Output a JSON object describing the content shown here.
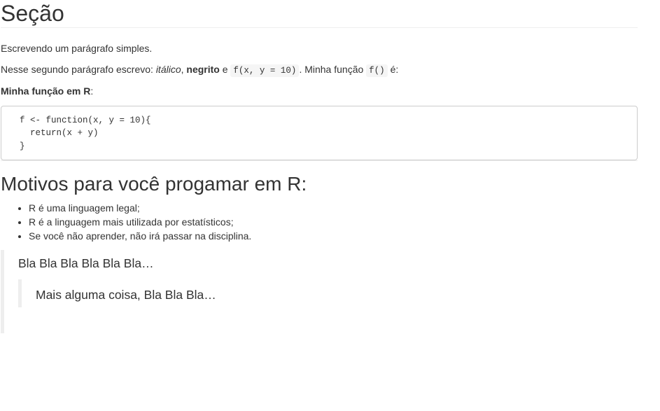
{
  "section": {
    "title": "Seção"
  },
  "paragraphs": {
    "p1": "Escrevendo um parágrafo simples.",
    "p2": {
      "prefix": "Nesse segundo parágrafo escrevo: ",
      "italic": "itálico",
      "sep1": ", ",
      "bold": "negrito",
      "sep2": " e ",
      "code1": "f(x, y = 10)",
      "mid": ". Minha função ",
      "code2": "f()",
      "suffix": " é:"
    },
    "p3": {
      "bold": "Minha função em R",
      "suffix": ":"
    }
  },
  "code_block": "f <- function(x, y = 10){\n  return(x + y)\n}",
  "subsection": {
    "title": "Motivos para você progamar em R:",
    "items": [
      "R é uma linguagem legal;",
      "R é a linguagem mais utilizada por estatísticos;",
      "Se você não aprender, não irá passar na disciplina."
    ]
  },
  "quotes": {
    "outer": "Bla Bla Bla Bla Bla Bla…",
    "inner": "Mais alguma coisa, Bla Bla Bla…"
  }
}
